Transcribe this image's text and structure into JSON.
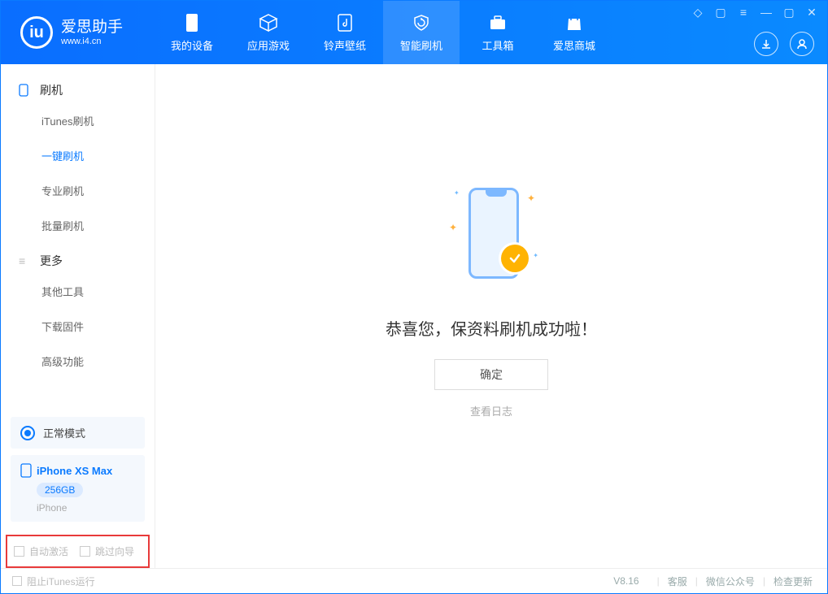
{
  "app": {
    "name_cn": "爱思助手",
    "name_en": "www.i4.cn"
  },
  "tabs": [
    {
      "id": "device",
      "label": "我的设备"
    },
    {
      "id": "apps",
      "label": "应用游戏"
    },
    {
      "id": "ring",
      "label": "铃声壁纸"
    },
    {
      "id": "flash",
      "label": "智能刷机"
    },
    {
      "id": "tools",
      "label": "工具箱"
    },
    {
      "id": "store",
      "label": "爱思商城"
    }
  ],
  "sidebar": {
    "group_flash": "刷机",
    "items_flash": [
      "iTunes刷机",
      "一键刷机",
      "专业刷机",
      "批量刷机"
    ],
    "group_more": "更多",
    "items_more": [
      "其他工具",
      "下载固件",
      "高级功能"
    ]
  },
  "mode_label": "正常模式",
  "device": {
    "name": "iPhone XS Max",
    "capacity": "256GB",
    "type": "iPhone"
  },
  "opts": {
    "auto_activate": "自动激活",
    "skip_guide": "跳过向导"
  },
  "result": {
    "message": "恭喜您，保资料刷机成功啦！",
    "ok": "确定",
    "log_link": "查看日志"
  },
  "footer": {
    "block_itunes": "阻止iTunes运行",
    "version": "V8.16",
    "links": [
      "客服",
      "微信公众号",
      "检查更新"
    ]
  }
}
